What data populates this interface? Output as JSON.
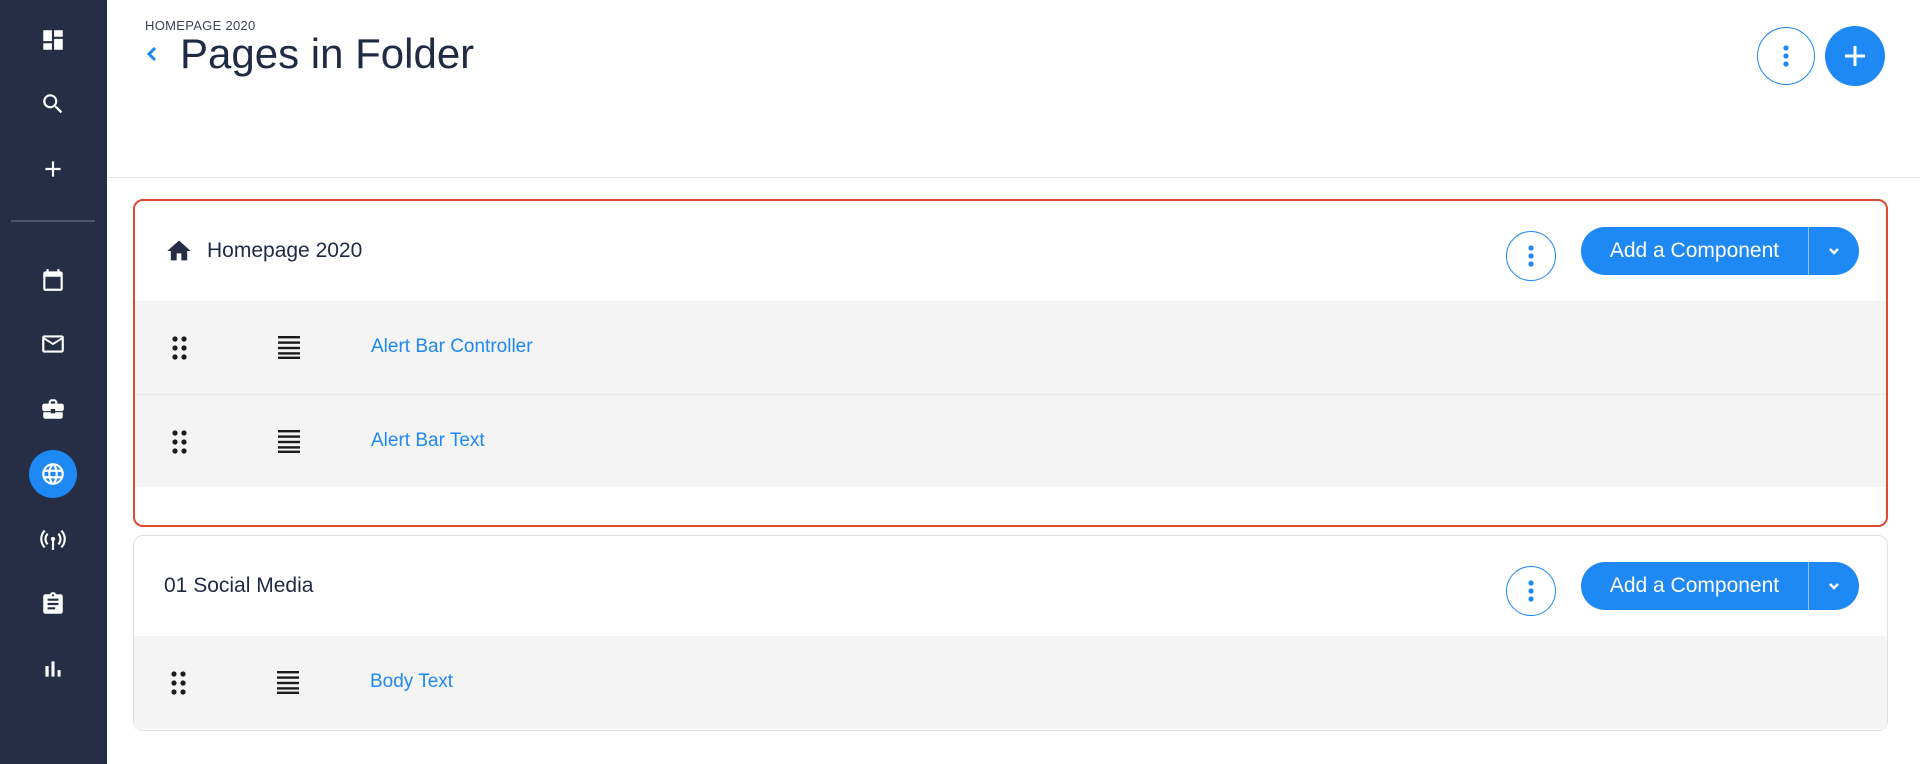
{
  "sidebar": {
    "items": [
      {
        "icon": "dashboard-icon",
        "name": "nav-dashboard"
      },
      {
        "icon": "search-icon",
        "name": "nav-search"
      },
      {
        "icon": "plus-icon",
        "name": "nav-add"
      },
      {
        "icon": "calendar-icon",
        "name": "nav-calendar"
      },
      {
        "icon": "mail-icon",
        "name": "nav-mail"
      },
      {
        "icon": "briefcase-icon",
        "name": "nav-briefcase"
      },
      {
        "icon": "globe-icon",
        "name": "nav-web",
        "active": true
      },
      {
        "icon": "broadcast-icon",
        "name": "nav-broadcast"
      },
      {
        "icon": "clipboard-icon",
        "name": "nav-clipboard"
      },
      {
        "icon": "bar-chart-icon",
        "name": "nav-analytics"
      }
    ]
  },
  "header": {
    "breadcrumb": "HOMEPAGE 2020",
    "title": "Pages in Folder"
  },
  "pages": [
    {
      "title": "Homepage 2020",
      "icon": "home-icon",
      "add_component_label": "Add a Component",
      "components": [
        "Alert Bar Controller",
        "Alert Bar Text"
      ]
    },
    {
      "title": "01 Social Media",
      "add_component_label": "Add a Component",
      "components": [
        "Body Text"
      ]
    }
  ],
  "colors": {
    "sidebar": "#252e44",
    "accent": "#1e88f5",
    "selection": "#e04a33",
    "row_bg": "#f4f4f5"
  }
}
